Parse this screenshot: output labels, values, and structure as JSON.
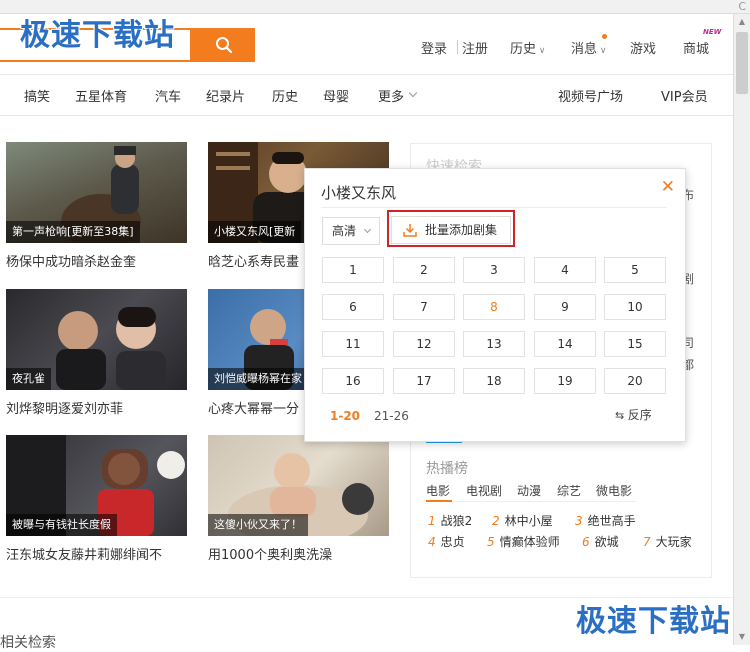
{
  "watermark": {
    "text": "极速下载站"
  },
  "header": {
    "nav": {
      "login": "登录",
      "register": "注册",
      "history": "历史",
      "messages": "消息",
      "games": "游戏",
      "mall": "商城",
      "new_badge": "NEW"
    }
  },
  "categories": {
    "items": [
      "搞笑",
      "五星体育",
      "汽车",
      "纪录片",
      "历史",
      "母婴",
      "更多"
    ],
    "right": [
      "视频号广场",
      "VIP会员"
    ]
  },
  "videos": [
    {
      "caption": "第一声枪响[更新至38集]",
      "desc": "杨保中成功暗杀赵金奎"
    },
    {
      "caption": "小楼又东风[更新",
      "desc": "晗芝心系寿民畫"
    },
    {
      "caption": "夜孔雀",
      "desc": "刘烨黎明逐爱刘亦菲"
    },
    {
      "caption": "刘恺威曝杨幂在家",
      "desc": "心疼大幂幂一分"
    },
    {
      "caption": "被曝与有钱社长度假",
      "desc": "汪东城女友藤井莉娜绯闻不"
    },
    {
      "caption": "这傻小伙又来了！",
      "desc": "用1000个奥利奥洗澡"
    }
  ],
  "sidebar": {
    "quick_search_title": "快速检索",
    "fragments": [
      "布",
      "剧",
      "司",
      "都"
    ],
    "hot_title": "热播榜",
    "hot_tabs": [
      "电影",
      "电视剧",
      "动漫",
      "综艺",
      "微电影"
    ],
    "hot_items": [
      {
        "rank": "1",
        "name": "战狼2"
      },
      {
        "rank": "2",
        "name": "林中小屋"
      },
      {
        "rank": "3",
        "name": "绝世高手"
      },
      {
        "rank": "4",
        "name": "忠贞"
      },
      {
        "rank": "5",
        "name": "情癫体验师"
      },
      {
        "rank": "6",
        "name": "欲城"
      },
      {
        "rank": "7",
        "name": "大玩家"
      }
    ]
  },
  "popup": {
    "title": "小楼又东风",
    "close": "✕",
    "quality": "高清",
    "batch_add": "批量添加剧集",
    "episodes": [
      "1",
      "2",
      "3",
      "4",
      "5",
      "6",
      "7",
      "8",
      "9",
      "10",
      "11",
      "12",
      "13",
      "14",
      "15",
      "16",
      "17",
      "18",
      "19",
      "20"
    ],
    "active_episode": "8",
    "pages": [
      "1-20",
      "21-26"
    ],
    "sort": "反序"
  },
  "footer": {
    "partial_text": "相关检索"
  },
  "colors": {
    "accent": "#f27c1e",
    "highlight_frame": "#d0232c",
    "watermark": "#2a6fc4"
  }
}
